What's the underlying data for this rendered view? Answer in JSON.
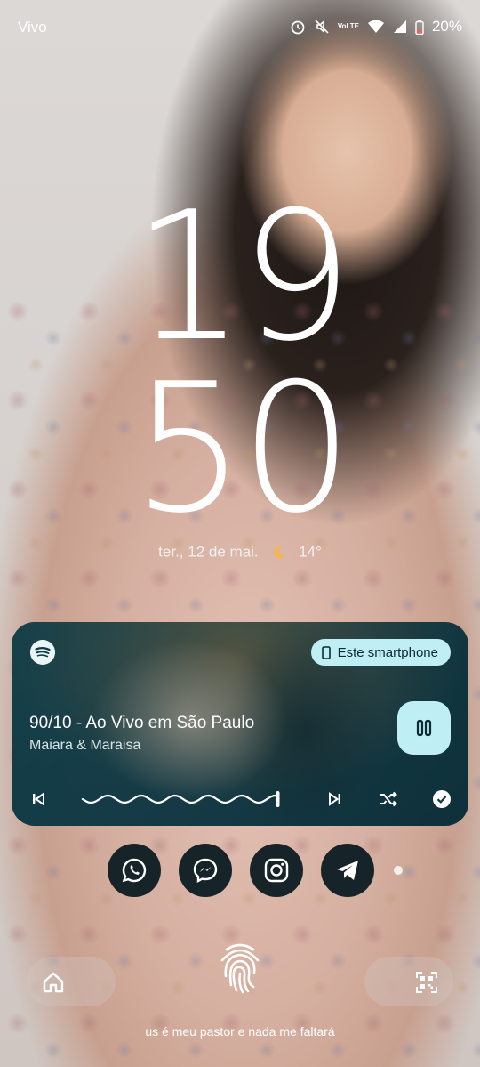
{
  "status_bar": {
    "carrier": "Vivo",
    "battery": "20%",
    "network": "VoLTE",
    "icons": [
      "alarm-icon",
      "mute-icon",
      "volte-icon",
      "wifi-icon",
      "signal-icon",
      "battery-icon"
    ]
  },
  "clock": {
    "hours": "19",
    "minutes": "50"
  },
  "date_weather": {
    "date": "ter., 12 de mai.",
    "temperature": "14°",
    "weather_icon": "moon-icon"
  },
  "media": {
    "app": "spotify-icon",
    "device_label": "Este smartphone",
    "title": "90/10 - Ao Vivo em São Paulo",
    "artist": "Maiara & Maraisa",
    "progress": 0.98,
    "accent": "#bfeef5"
  },
  "shortcuts": [
    "whatsapp-icon",
    "messenger-icon",
    "instagram-icon",
    "telegram-icon"
  ],
  "owner_info": "us é meu pastor e nada me faltará"
}
